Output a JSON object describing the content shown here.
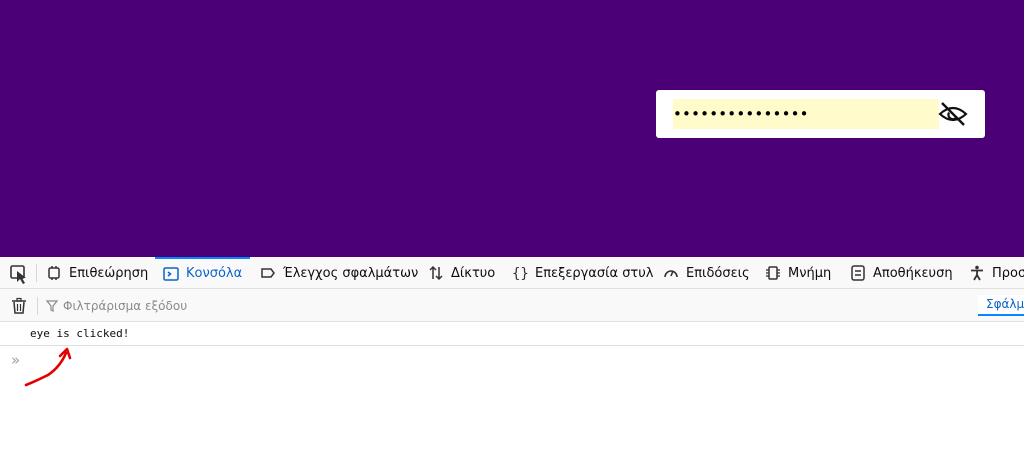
{
  "page": {
    "password": {
      "masked_value": "•••••••••••••••",
      "eye_icon": "eye-slash-icon",
      "field_bg": "#fffbca",
      "page_bg": "#4b0077"
    }
  },
  "devtools": {
    "tabs": [
      {
        "label": "Επιθεώρηση",
        "icon": "inspector-icon"
      },
      {
        "label": "Κονσόλα",
        "icon": "console-icon",
        "active": true
      },
      {
        "label": "Έλεγχος σφαλμάτων",
        "icon": "debugger-icon"
      },
      {
        "label": "Δίκτυο",
        "icon": "network-icon"
      },
      {
        "label": "Επεξεργασία στυλ",
        "icon": "style-editor-icon"
      },
      {
        "label": "Επιδόσεις",
        "icon": "performance-icon"
      },
      {
        "label": "Μνήμη",
        "icon": "memory-icon"
      },
      {
        "label": "Αποθήκευση",
        "icon": "storage-icon"
      },
      {
        "label": "Προσ",
        "icon": "accessibility-icon"
      }
    ],
    "filter_placeholder": "Φιλτράρισμα εξόδου",
    "errors_button": "Σφάλμ",
    "log_messages": [
      "eye is clicked!"
    ],
    "prompt_symbol": "»",
    "accent_color": "#0a84ff"
  }
}
